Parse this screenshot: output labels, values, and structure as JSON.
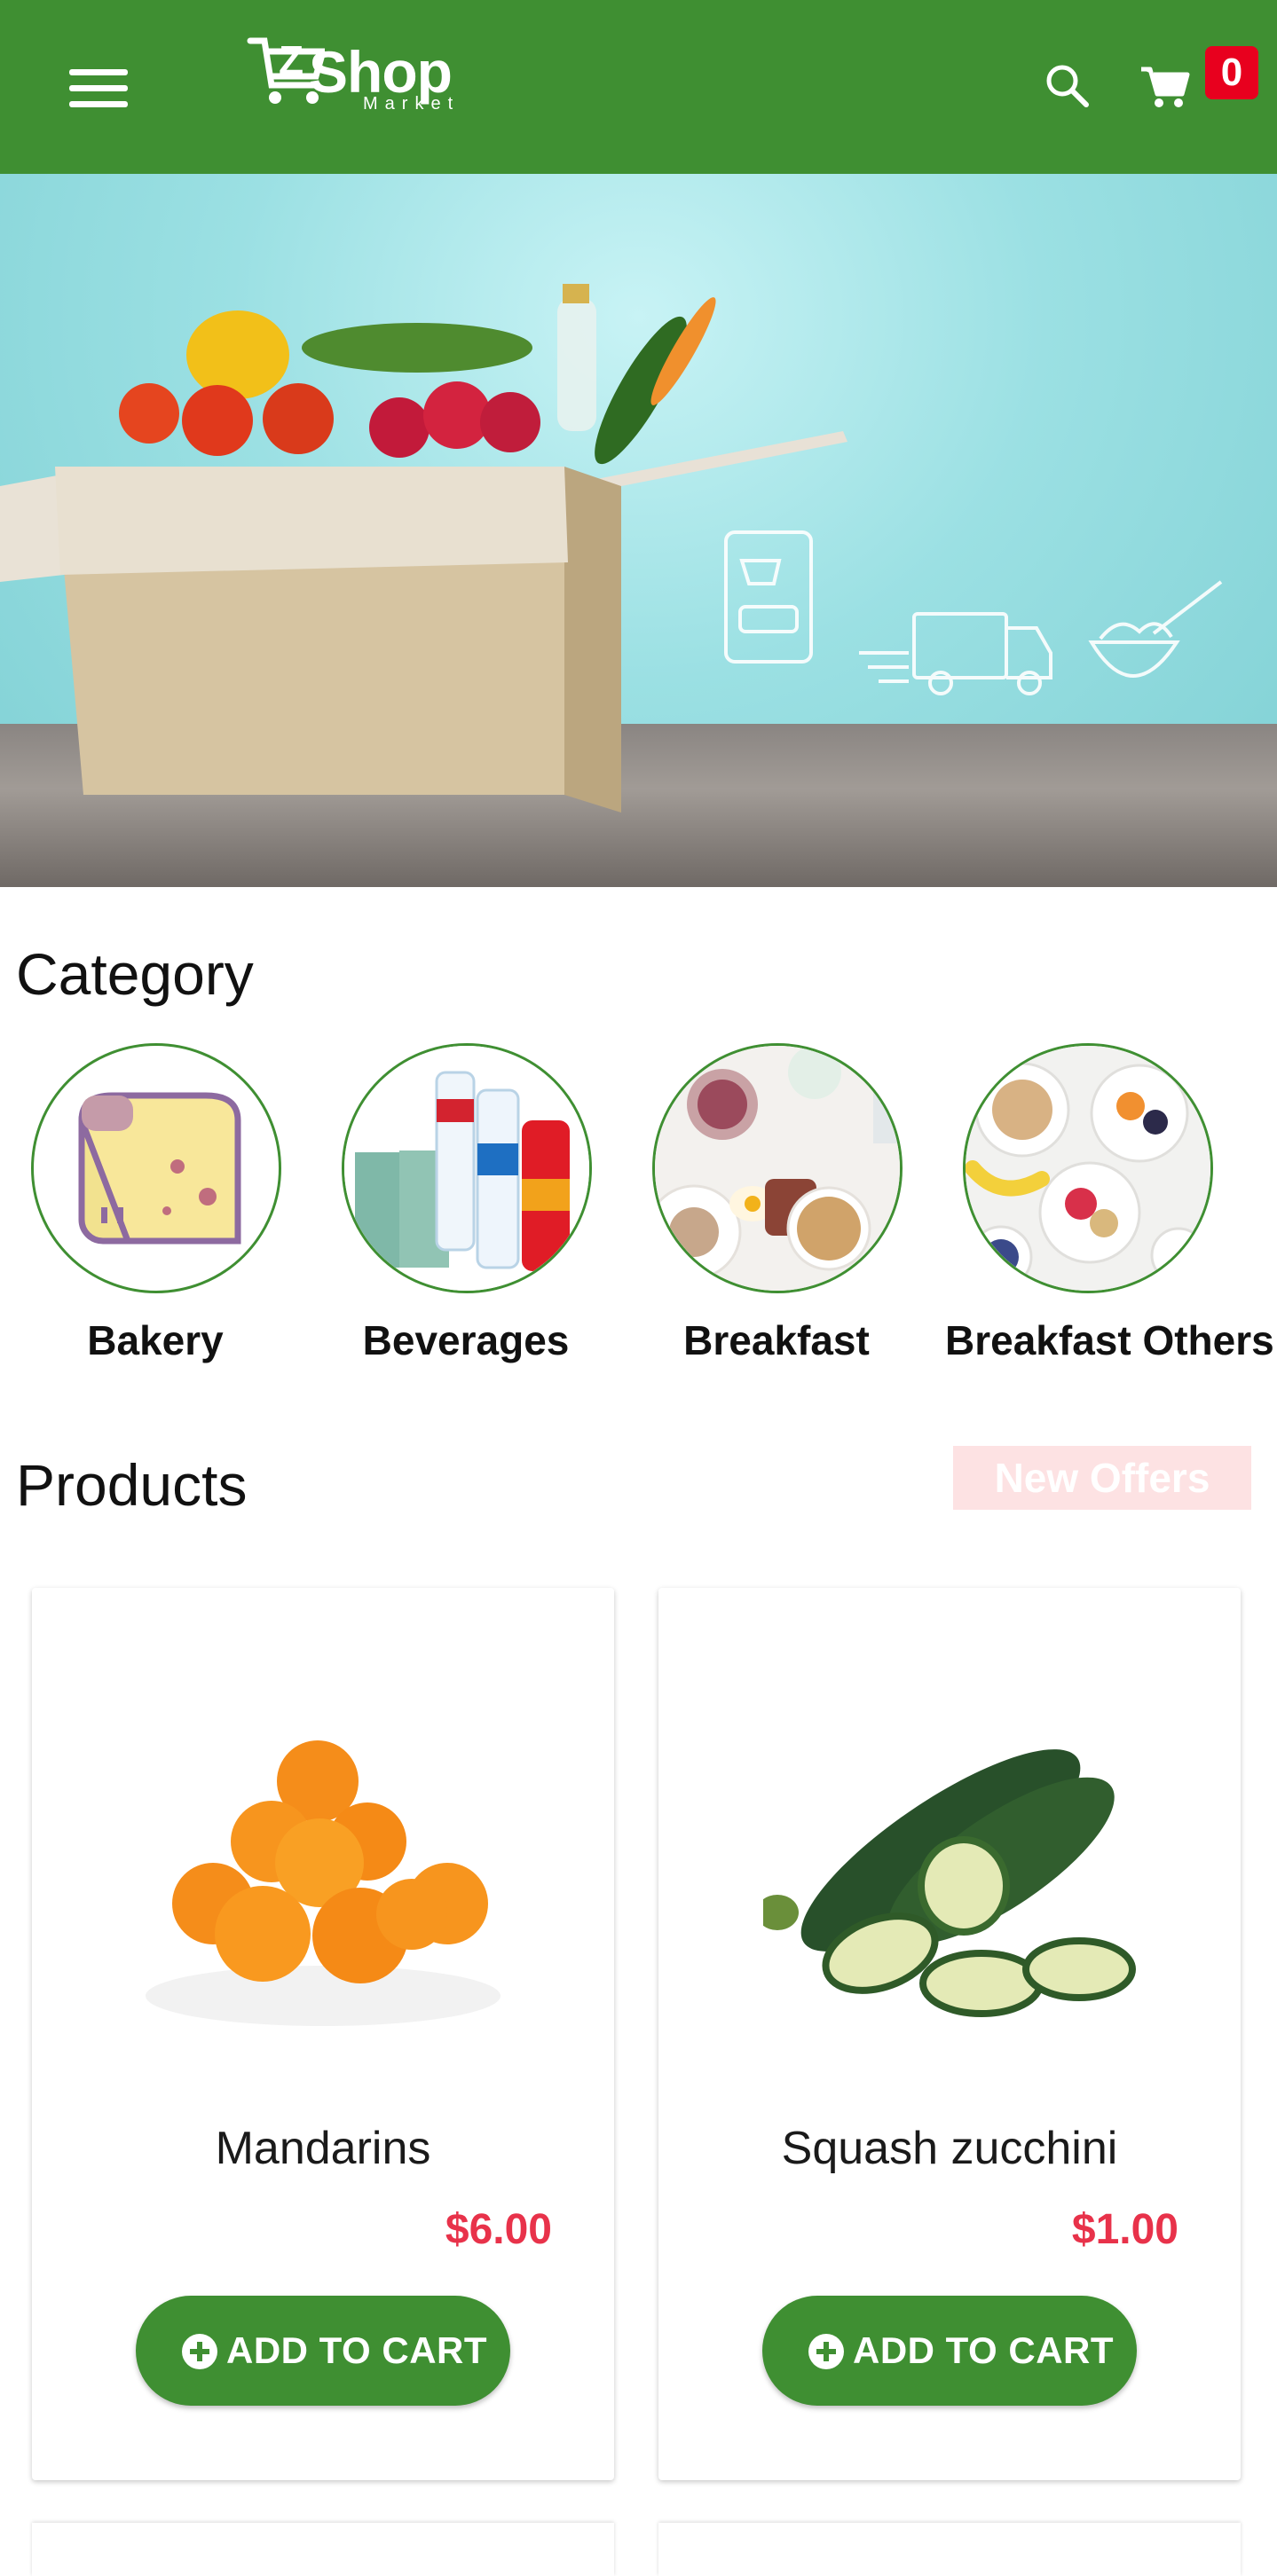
{
  "header": {
    "logo_text": "Shop",
    "logo_sub": "Market",
    "cart_count": "0"
  },
  "sections": {
    "category_title": "Category",
    "products_title": "Products",
    "new_offers_label": "New Offers"
  },
  "categories": [
    {
      "label": "Bakery",
      "image": "bread-icon"
    },
    {
      "label": "Beverages",
      "image": "drinks-photo"
    },
    {
      "label": "Breakfast",
      "image": "breakfast-photo"
    },
    {
      "label": "Breakfast Others",
      "image": "fruit-bowls-photo"
    }
  ],
  "products": [
    {
      "name": "Mandarins",
      "price": "$6.00",
      "button": "ADD TO CART",
      "image": "mandarins-photo"
    },
    {
      "name": "Squash zucchini",
      "price": "$1.00",
      "button": "ADD TO CART",
      "image": "zucchini-photo"
    }
  ],
  "colors": {
    "brand_green": "#3f8f32",
    "price_red": "#e8324a",
    "badge_red": "#e8001e"
  }
}
